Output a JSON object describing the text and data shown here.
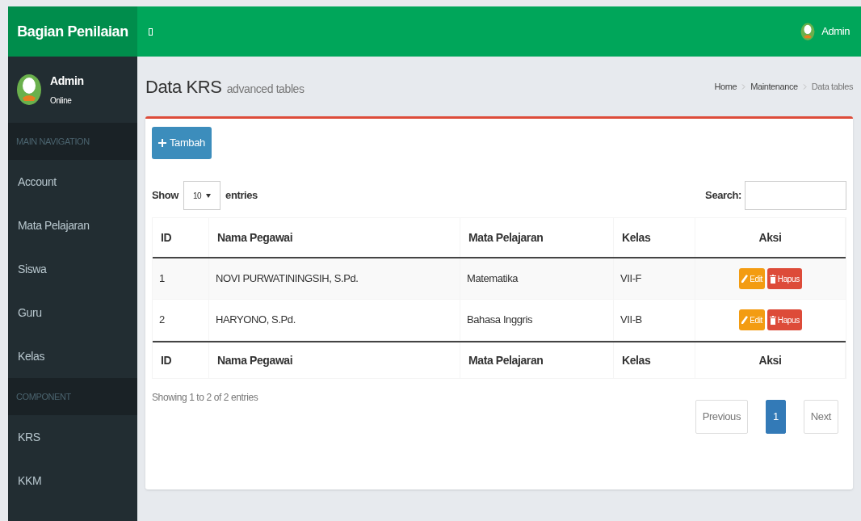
{
  "brand": "Bagian Penilaian",
  "topbar": {
    "user": "Admin"
  },
  "user_panel": {
    "name": "Admin",
    "status": "Online"
  },
  "sidebar": [
    {
      "kind": "header",
      "label": "MAIN NAVIGATION"
    },
    {
      "kind": "item",
      "label": "Account",
      "selected": false
    },
    {
      "kind": "item",
      "label": "Mata Pelajaran",
      "selected": false
    },
    {
      "kind": "item",
      "label": "Siswa",
      "selected": false
    },
    {
      "kind": "item",
      "label": "Guru",
      "selected": false
    },
    {
      "kind": "item",
      "label": "Kelas",
      "selected": false
    },
    {
      "kind": "header",
      "label": "COMPONENT"
    },
    {
      "kind": "item",
      "label": "KRS",
      "selected": false
    },
    {
      "kind": "item",
      "label": "KKM",
      "selected": false
    }
  ],
  "page": {
    "title": "Data KRS",
    "subtitle": "advanced tables"
  },
  "breadcrumb": [
    "Home",
    "Maintenance",
    "Data tables"
  ],
  "add_button": "Tambah",
  "length": {
    "before": "Show",
    "value": "10",
    "after": "entries"
  },
  "search": {
    "label": "Search:"
  },
  "table": {
    "columns": [
      "ID",
      "Nama Pegawai",
      "Mata Pelajaran",
      "Kelas",
      "Aksi"
    ],
    "rows": [
      {
        "cells": [
          "1",
          "NOVI PURWATININGSIH, S.Pd.",
          "Matematika",
          "VII-F"
        ],
        "actions": [
          "Edit",
          "Hapus"
        ]
      },
      {
        "cells": [
          "2",
          "HARYONO, S.Pd.",
          "Bahasa Inggris",
          "VII-B"
        ],
        "actions": [
          "Edit",
          "Hapus"
        ]
      }
    ],
    "footer": [
      "ID",
      "Nama Pegawai",
      "Mata Pelajaran",
      "Kelas",
      "Aksi"
    ]
  },
  "info": "Showing 1 to 2 of 2 entries",
  "pagination": [
    {
      "label": "Previous",
      "selected": false
    },
    {
      "label": "1",
      "selected": true
    },
    {
      "label": "Next",
      "selected": false
    }
  ]
}
